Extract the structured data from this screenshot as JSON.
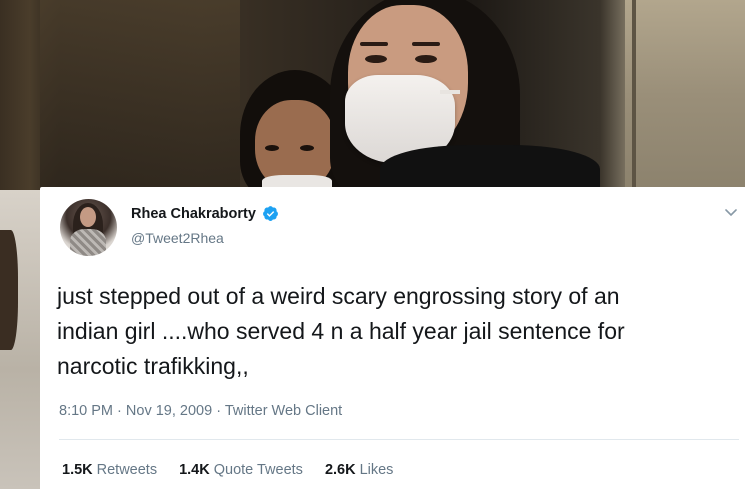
{
  "tweet": {
    "display_name": "Rhea Chakraborty",
    "handle": "@Tweet2Rhea",
    "text_lines": [
      "just stepped out of a weird scary engrossing story of an",
      "indian girl ....who served 4 n a half year jail sentence for",
      "narcotic trafikking,,"
    ],
    "time": "8:10 PM",
    "date": "Nov 19, 2009",
    "client": "Twitter Web Client",
    "separator": "·",
    "stats": {
      "retweets_count": "1.5K",
      "retweets_label": "Retweets",
      "quotes_count": "1.4K",
      "quotes_label": "Quote Tweets",
      "likes_count": "2.6K",
      "likes_label": "Likes"
    },
    "icons": {
      "verified": "verified-badge-icon",
      "menu": "chevron-down-icon"
    },
    "colors": {
      "verified_blue": "#1da1f2",
      "text_primary": "#14171a",
      "text_secondary": "#657786"
    }
  }
}
